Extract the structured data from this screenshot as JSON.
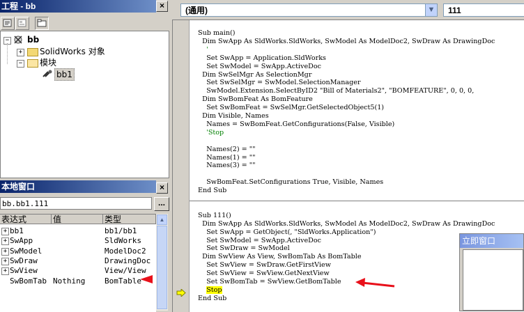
{
  "project_pane": {
    "title": "工程 - bb",
    "close": "×",
    "tree": {
      "root": "bb",
      "solidworks_objects": "SolidWorks 对象",
      "modules": "模块",
      "module_item": "bb1"
    }
  },
  "watch_pane": {
    "title": "本地窗口",
    "close": "×",
    "path": "bb.bb1.111",
    "ellipsis": "...",
    "headers": {
      "expr": "表达式",
      "value": "值",
      "type": "类型"
    },
    "rows": [
      {
        "expr": "bb1",
        "value": "",
        "type": "bb1/bb1",
        "expandable": true
      },
      {
        "expr": "SwApp",
        "value": "",
        "type": "SldWorks",
        "expandable": true
      },
      {
        "expr": "SwModel",
        "value": "",
        "type": "ModelDoc2",
        "expandable": true
      },
      {
        "expr": "SwDraw",
        "value": "",
        "type": "DrawingDoc",
        "expandable": true
      },
      {
        "expr": "SwView",
        "value": "",
        "type": "View/View",
        "expandable": true
      },
      {
        "expr": "SwBomTab",
        "value": "Nothing",
        "type": "BomTable",
        "expandable": false
      }
    ]
  },
  "code_window": {
    "object_combo": "(通用)",
    "proc_combo": "111",
    "lines": [
      "Sub main()",
      "  Dim SwApp As SldWorks.SldWorks, SwModel As ModelDoc2, SwDraw As DrawingDoc",
      "    '",
      "    Set SwApp = Application.SldWorks",
      "    Set SwModel = SwApp.ActiveDoc",
      "  Dim SwSelMgr As SelectionMgr",
      "    Set SwSelMgr = SwModel.SelectionManager",
      "    SwModel.Extension.SelectByID2 \"Bill of Materials2\", \"BOMFEATURE\", 0, 0, 0,",
      "  Dim SwBomFeat As BomFeature",
      "    Set SwBomFeat = SwSelMgr.GetSelectedObject5(1)",
      "  Dim Visible, Names",
      "    Names = SwBomFeat.GetConfigurations(False, Visible)",
      "    'Stop",
      "",
      "    Names(2) = \"\"",
      "    Names(1) = \"\"",
      "    Names(3) = \"\"",
      "",
      "    SwBomFeat.SetConfigurations True, Visible, Names",
      "End Sub",
      "",
      "",
      "Sub 111()",
      "  Dim SwApp As SldWorks.SldWorks, SwModel As ModelDoc2, SwDraw As DrawingDoc",
      "    Set SwApp = GetObject(, \"SldWorks.Application\")",
      "    Set SwModel = SwApp.ActiveDoc",
      "    Set SwDraw = SwModel",
      "  Dim SwView As View, SwBomTab As BomTable",
      "    Set SwView = SwDraw.GetFirstView",
      "    Set SwView = SwView.GetNextView",
      "    Set SwBomTab = SwView.GetBomTable",
      "    Stop",
      "End Sub"
    ]
  },
  "immediate_window": {
    "title": "立即窗口"
  },
  "colors": {
    "arrow": "#e8101a",
    "exec_highlight": "#ffff00",
    "comment": "#008000",
    "title_blue": "#0a246a"
  }
}
